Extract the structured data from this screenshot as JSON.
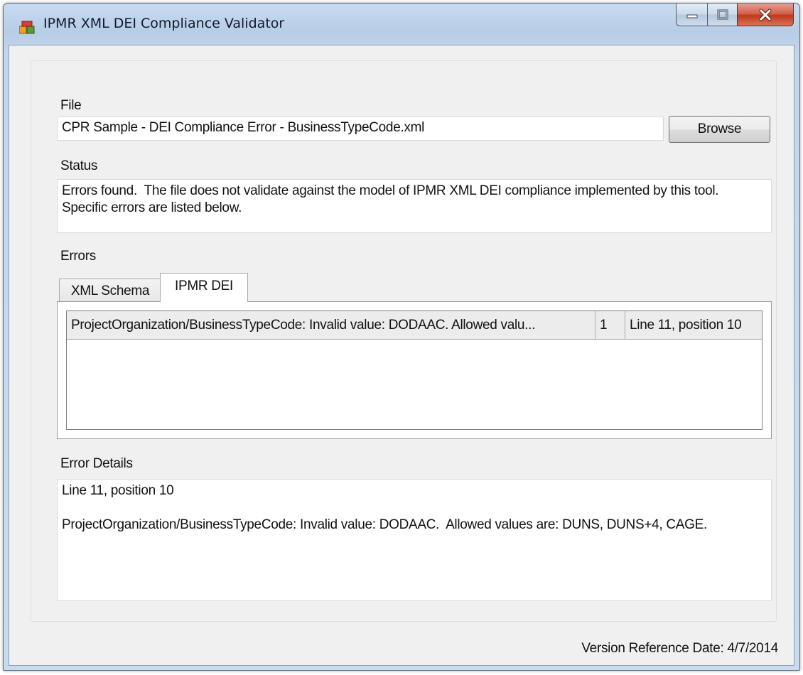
{
  "window": {
    "title": "IPMR XML DEI Compliance Validator"
  },
  "file": {
    "label": "File",
    "value": "CPR Sample - DEI Compliance Error - BusinessTypeCode.xml",
    "browse_label": "Browse"
  },
  "status": {
    "label": "Status",
    "text": "Errors found.  The file does not validate against the model of IPMR XML DEI compliance implemented by this tool.  Specific errors are listed below."
  },
  "errors": {
    "label": "Errors",
    "tabs": [
      {
        "label": "XML Schema",
        "active": false
      },
      {
        "label": "IPMR DEI",
        "active": true
      }
    ],
    "rows": [
      {
        "message": "ProjectOrganization/BusinessTypeCode: Invalid value: DODAAC.  Allowed valu...",
        "count": "1",
        "location": "Line 11, position 10"
      }
    ]
  },
  "error_details": {
    "label": "Error Details",
    "text": "Line 11, position 10\n\nProjectOrganization/BusinessTypeCode: Invalid value: DODAAC.  Allowed values are: DUNS, DUNS+4, CAGE."
  },
  "footer": {
    "version_text": "Version Reference Date: 4/7/2014"
  },
  "colors": {
    "close_button": "#c0391c",
    "title_bar": "#b7cde6",
    "client_background": "#f0f0f0"
  },
  "icons": [
    "app-icon",
    "minimize-icon",
    "maximize-icon",
    "close-icon"
  ]
}
